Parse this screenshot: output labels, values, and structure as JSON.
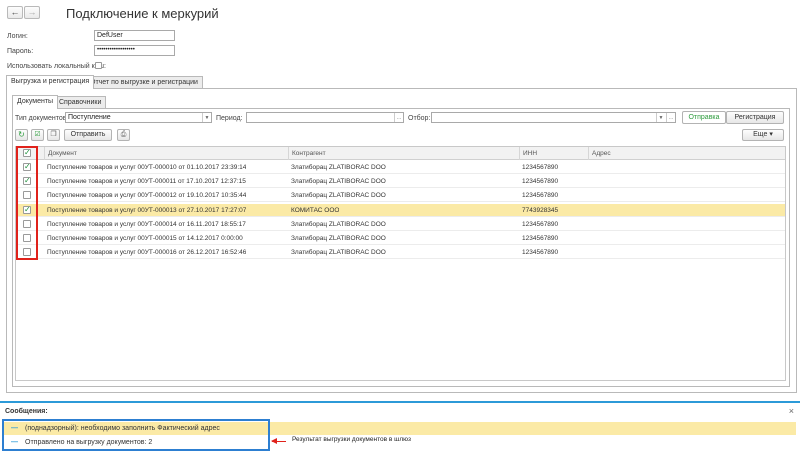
{
  "window": {
    "title": "Подключение к меркурий",
    "back_icon": "←",
    "forward_icon": "→"
  },
  "login": {
    "login_label": "Логин:",
    "login_value": "DefUser",
    "password_label": "Пароль:",
    "password_value": "••••••••••••••••••",
    "cache_label": "Использовать локальный кэш:"
  },
  "outer_tabs": [
    {
      "label": "Выгрузка и регистрация",
      "active": true
    },
    {
      "label": "Отчет по выгрузке и регистрации",
      "active": false
    }
  ],
  "inner_tabs": [
    {
      "label": "Документы",
      "active": true
    },
    {
      "label": "Справочники",
      "active": false
    }
  ],
  "filters": {
    "doc_type_label": "Тип документов:",
    "doc_type_value": "Поступление",
    "period_label": "Период:",
    "period_value": "",
    "filter_label": "Отбор:",
    "filter_value": "",
    "send_tab": "Отправка",
    "register_tab": "Регистрация"
  },
  "toolbar": {
    "send_label": "Отправить",
    "more_label": "Еще",
    "more_arrow": "▾"
  },
  "grid": {
    "columns": [
      "Документ",
      "Контрагент",
      "ИНН",
      "Адрес"
    ],
    "rows": [
      {
        "checked": true,
        "doc": "Поступление товаров и услуг 00УТ-000010 от 01.10.2017 23:39:14",
        "partner": "Злати​бора​ц ZLATIBORAC DOO",
        "inn": "1234567890",
        "address": "",
        "selected": false
      },
      {
        "checked": true,
        "doc": "Поступление товаров и услуг 00УТ-000011 от 17.10.2017 12:37:15",
        "partner": "Златиборац ZLATIBORAC DOO",
        "inn": "1234567890",
        "address": "",
        "selected": false
      },
      {
        "checked": false,
        "doc": "Поступление товаров и услуг 00УТ-000012 от 19.10.2017 10:35:44",
        "partner": "Златиборац ZLATIBORAC DOO",
        "inn": "1234567890",
        "address": "",
        "selected": false
      },
      {
        "checked": true,
        "doc": "Поступление товаров и услуг 00УТ-000013 от 27.10.2017 17:27:07",
        "partner": "КОМИТАС ООО",
        "inn": "7743928345",
        "address": "",
        "selected": true
      },
      {
        "checked": false,
        "doc": "Поступление товаров и услуг 00УТ-000014 от 16.11.2017 18:55:17",
        "partner": "Златиборац ZLATIBORAC DOO",
        "inn": "1234567890",
        "address": "",
        "selected": false
      },
      {
        "checked": false,
        "doc": "Поступление товаров и услуг 00УТ-000015 от 14.12.2017 0:00:00",
        "partner": "Златиборац ZLATIBORAC DOO",
        "inn": "1234567890",
        "address": "",
        "selected": false
      },
      {
        "checked": false,
        "doc": "Поступление товаров и услуг 00УТ-000016 от 26.12.2017 16:52:46",
        "partner": "Златиборац ZLATIBORAC DOO",
        "inn": "1234567890",
        "address": "",
        "selected": false
      }
    ]
  },
  "messages": {
    "title": "Сообщения:",
    "close_icon": "×",
    "items": [
      {
        "text": "(поднадзорный): необходимо заполнить Фактический адрес",
        "warn": true
      },
      {
        "text": "Отправлено на выгрузку документов: 2",
        "warn": false
      }
    ],
    "annotation": "Результат выгрузки документов в шлюз"
  },
  "colors": {
    "accent_blue": "#2c9ad8",
    "highlight": "#fbeaa6",
    "check_green": "#1c8f3a",
    "annotation_red": "#e0221b",
    "send_tab_green": "#2e9c3e"
  }
}
